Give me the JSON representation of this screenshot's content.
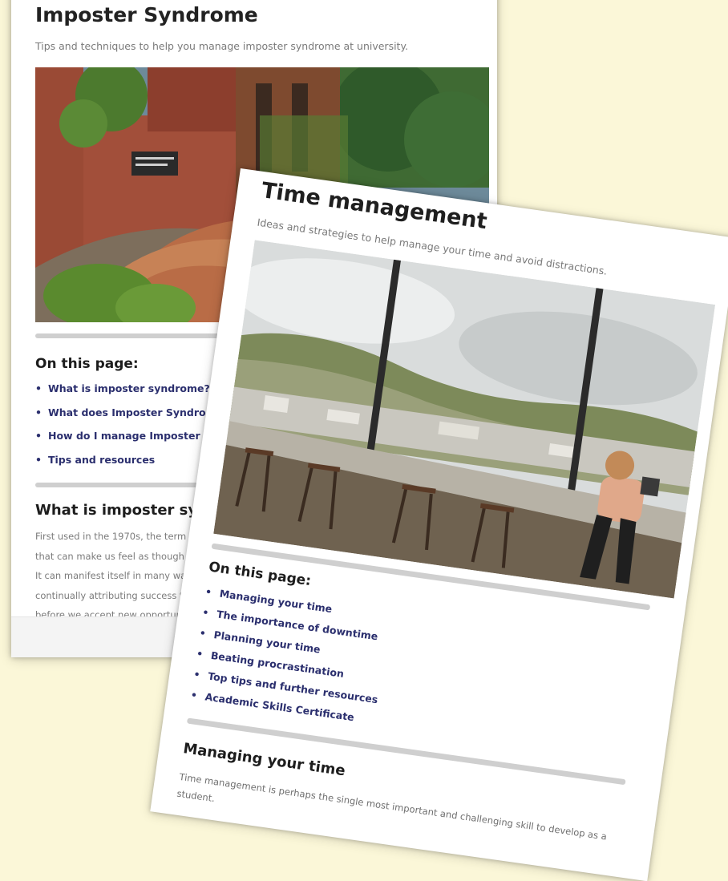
{
  "imposter_card": {
    "title": "Imposter Syndrome",
    "subtitle": "Tips and techniques to help you manage imposter syndrome at university.",
    "hero_image": "campus-building-with-ivy-photo",
    "on_this_page_heading": "On this page:",
    "links": [
      "What is imposter syndrome?",
      "What does Imposter Syndrome look li",
      "How do I manage Imposter Syndrom",
      "Tips and resources"
    ],
    "section_heading": "What is imposter syndro",
    "paragraph_lines": [
      "First used in the 1970s, the term 'imp",
      "that can make us feel as though we",
      "It can manifest itself in many ways",
      "continually attributing success to",
      "before we accept new opportuni"
    ]
  },
  "time_card": {
    "title": "Time management",
    "subtitle": "Ideas and strategies to help manage your time and avoid distractions.",
    "hero_image": "student-at-window-bar-photo",
    "on_this_page_heading": "On this page:",
    "links": [
      "Managing your time",
      "The importance of downtime",
      "Planning your time",
      "Beating procrastination",
      "Top tips and further resources",
      "Academic Skills Certificate"
    ],
    "section_heading": "Managing your time",
    "paragraph": "Time management is perhaps the single most important and challenging skill to develop as a student."
  },
  "colors": {
    "background": "#fbf7d8",
    "link": "#2b2f6e",
    "divider": "#cfcfcf"
  }
}
